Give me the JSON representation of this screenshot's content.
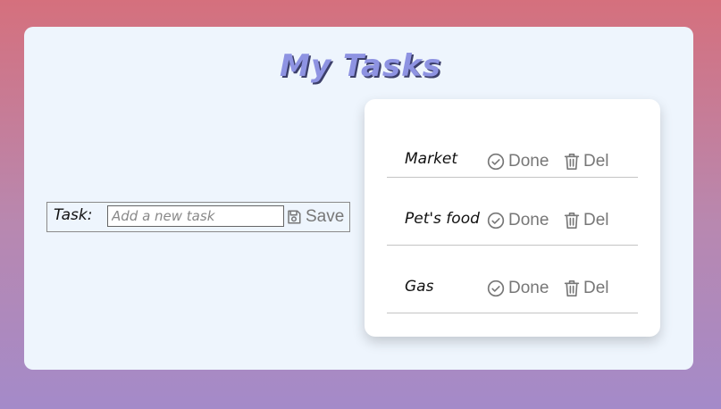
{
  "app": {
    "title": "My Tasks"
  },
  "form": {
    "label": "Task:",
    "input_value": "",
    "input_placeholder": "Add a new task",
    "save_label": "Save",
    "save_icon": "floppy-disk-icon"
  },
  "tasks": [
    {
      "name": "Market",
      "done_label": "Done",
      "del_label": "Del"
    },
    {
      "name": "Pet's food",
      "done_label": "Done",
      "del_label": "Del"
    },
    {
      "name": "Gas",
      "done_label": "Done",
      "del_label": "Del"
    }
  ],
  "icons": {
    "done": "check-circle-icon",
    "delete": "trash-icon"
  },
  "colors": {
    "background_top": "#d5707d",
    "background_bottom": "#a48ac9",
    "card": "#eef5fd",
    "title": "#8e93e2",
    "title_shadow": "#3c3f6a",
    "button_text": "#777777",
    "divider": "#c4c4c4"
  }
}
